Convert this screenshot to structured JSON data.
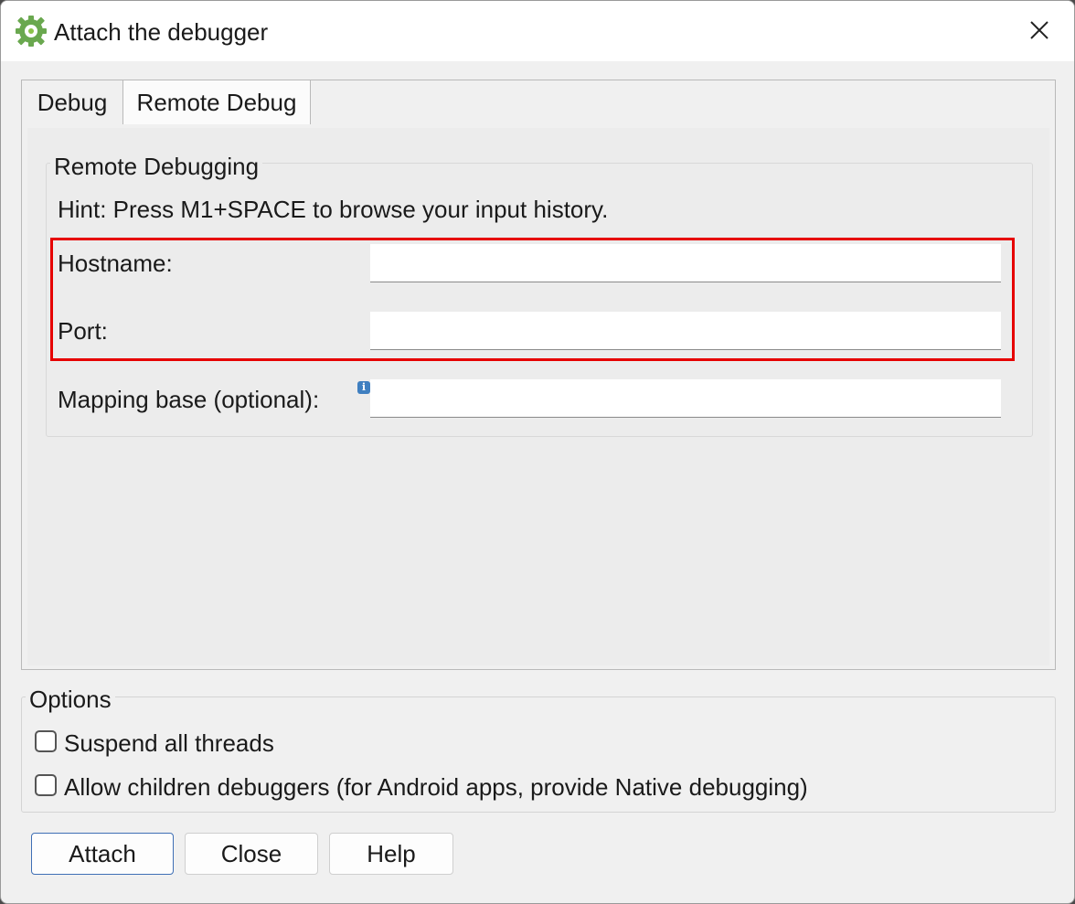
{
  "window": {
    "title": "Attach the debugger",
    "accent_color": "#3f6fb5",
    "highlight_color": "#e60000"
  },
  "tabs": [
    {
      "label": "Debug",
      "selected": false
    },
    {
      "label": "Remote Debug",
      "selected": true
    }
  ],
  "remote": {
    "group_title": "Remote Debugging",
    "hint": "Hint: Press M1+SPACE to browse your input history.",
    "hostname_label": "Hostname:",
    "hostname_value": "",
    "port_label": "Port:",
    "port_value": "",
    "mapping_label": "Mapping base (optional):",
    "mapping_value": "",
    "info_icon": "info-icon"
  },
  "options": {
    "group_title": "Options",
    "suspend_label": "Suspend all threads",
    "suspend_checked": false,
    "children_label": "Allow children debuggers (for Android apps, provide Native debugging)",
    "children_checked": false
  },
  "buttons": {
    "attach": "Attach",
    "close": "Close",
    "help": "Help"
  }
}
